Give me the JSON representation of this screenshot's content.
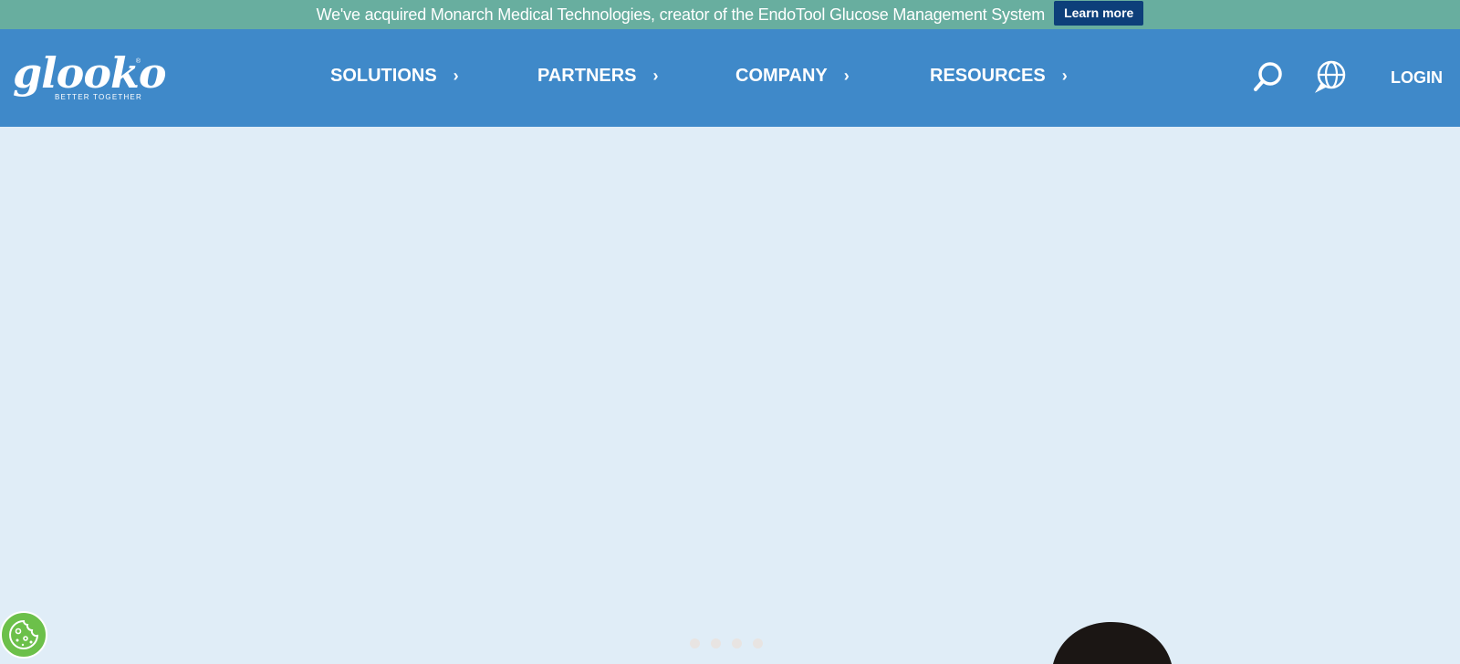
{
  "announcement": {
    "text": "We've acquired Monarch Medical Technologies, creator of the EndoTool Glucose Management System",
    "cta_label": "Learn more"
  },
  "brand": {
    "logo_text": "glooko",
    "tagline": "BETTER TOGETHER",
    "registered_mark": "®"
  },
  "nav": {
    "items": [
      {
        "label": "SOLUTIONS"
      },
      {
        "label": "PARTNERS"
      },
      {
        "label": "COMPANY"
      },
      {
        "label": "RESOURCES"
      }
    ],
    "chevron": "›",
    "search_icon": "search-icon",
    "language_icon": "globe-icon",
    "login_label": "LOGIN"
  },
  "carousel": {
    "slide_count": 4
  },
  "cookie": {
    "icon": "cookie-icon"
  },
  "colors": {
    "announcement_bg": "#68ae9f",
    "cta_bg": "#0d3f7a",
    "navbar_bg": "#3f89c9",
    "hero_bg": "#e0edf7",
    "cookie_bg": "#6cc04a"
  }
}
